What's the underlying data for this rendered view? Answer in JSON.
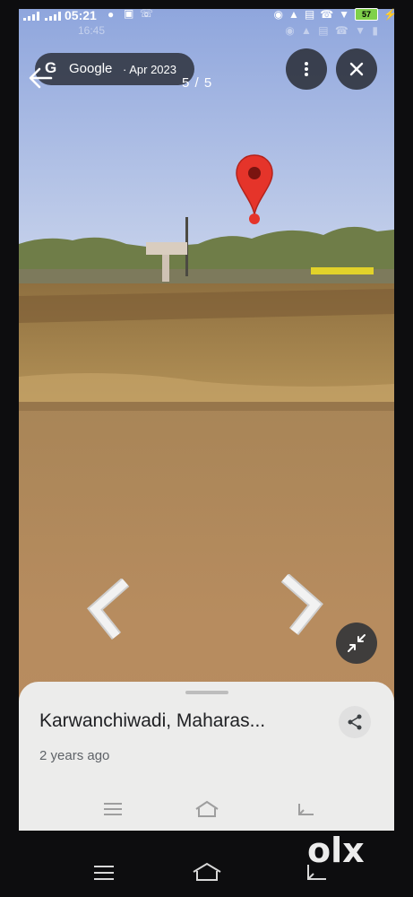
{
  "status_bar": {
    "time": "05:21",
    "battery": "57"
  },
  "status_bar_secondary": {
    "time": "16:45"
  },
  "header": {
    "google_logo": "G",
    "brand": "Google",
    "date": "· Apr 2023",
    "counter": "5 / 5"
  },
  "info_sheet": {
    "place": "Karwanchiwadi, Maharas...",
    "age": "2 years ago"
  },
  "watermark": {
    "text": "olx"
  },
  "icons": {
    "back": "arrow-left-icon",
    "more": "more-vert-icon",
    "close": "close-icon",
    "pin": "map-pin-icon",
    "prev": "chevron-left-icon",
    "next": "chevron-right-icon",
    "compress": "fullscreen-exit-icon",
    "share": "share-icon",
    "menu": "menu-icon",
    "home": "home-icon",
    "back_nav": "back-icon"
  },
  "colors": {
    "pin": "#e5342a",
    "sky": "#a7bcea",
    "water": "#b48a5c",
    "battery": "#7fd14a"
  }
}
